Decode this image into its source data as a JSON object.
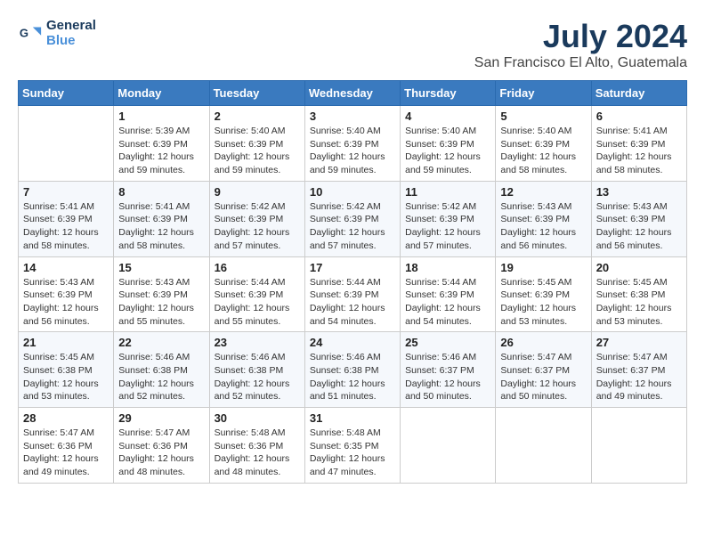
{
  "logo": {
    "line1": "General",
    "line2": "Blue"
  },
  "title": "July 2024",
  "location": "San Francisco El Alto, Guatemala",
  "days_of_week": [
    "Sunday",
    "Monday",
    "Tuesday",
    "Wednesday",
    "Thursday",
    "Friday",
    "Saturday"
  ],
  "weeks": [
    [
      {
        "day": "",
        "info": ""
      },
      {
        "day": "1",
        "info": "Sunrise: 5:39 AM\nSunset: 6:39 PM\nDaylight: 12 hours\nand 59 minutes."
      },
      {
        "day": "2",
        "info": "Sunrise: 5:40 AM\nSunset: 6:39 PM\nDaylight: 12 hours\nand 59 minutes."
      },
      {
        "day": "3",
        "info": "Sunrise: 5:40 AM\nSunset: 6:39 PM\nDaylight: 12 hours\nand 59 minutes."
      },
      {
        "day": "4",
        "info": "Sunrise: 5:40 AM\nSunset: 6:39 PM\nDaylight: 12 hours\nand 59 minutes."
      },
      {
        "day": "5",
        "info": "Sunrise: 5:40 AM\nSunset: 6:39 PM\nDaylight: 12 hours\nand 58 minutes."
      },
      {
        "day": "6",
        "info": "Sunrise: 5:41 AM\nSunset: 6:39 PM\nDaylight: 12 hours\nand 58 minutes."
      }
    ],
    [
      {
        "day": "7",
        "info": "Sunrise: 5:41 AM\nSunset: 6:39 PM\nDaylight: 12 hours\nand 58 minutes."
      },
      {
        "day": "8",
        "info": "Sunrise: 5:41 AM\nSunset: 6:39 PM\nDaylight: 12 hours\nand 58 minutes."
      },
      {
        "day": "9",
        "info": "Sunrise: 5:42 AM\nSunset: 6:39 PM\nDaylight: 12 hours\nand 57 minutes."
      },
      {
        "day": "10",
        "info": "Sunrise: 5:42 AM\nSunset: 6:39 PM\nDaylight: 12 hours\nand 57 minutes."
      },
      {
        "day": "11",
        "info": "Sunrise: 5:42 AM\nSunset: 6:39 PM\nDaylight: 12 hours\nand 57 minutes."
      },
      {
        "day": "12",
        "info": "Sunrise: 5:43 AM\nSunset: 6:39 PM\nDaylight: 12 hours\nand 56 minutes."
      },
      {
        "day": "13",
        "info": "Sunrise: 5:43 AM\nSunset: 6:39 PM\nDaylight: 12 hours\nand 56 minutes."
      }
    ],
    [
      {
        "day": "14",
        "info": "Sunrise: 5:43 AM\nSunset: 6:39 PM\nDaylight: 12 hours\nand 56 minutes."
      },
      {
        "day": "15",
        "info": "Sunrise: 5:43 AM\nSunset: 6:39 PM\nDaylight: 12 hours\nand 55 minutes."
      },
      {
        "day": "16",
        "info": "Sunrise: 5:44 AM\nSunset: 6:39 PM\nDaylight: 12 hours\nand 55 minutes."
      },
      {
        "day": "17",
        "info": "Sunrise: 5:44 AM\nSunset: 6:39 PM\nDaylight: 12 hours\nand 54 minutes."
      },
      {
        "day": "18",
        "info": "Sunrise: 5:44 AM\nSunset: 6:39 PM\nDaylight: 12 hours\nand 54 minutes."
      },
      {
        "day": "19",
        "info": "Sunrise: 5:45 AM\nSunset: 6:39 PM\nDaylight: 12 hours\nand 53 minutes."
      },
      {
        "day": "20",
        "info": "Sunrise: 5:45 AM\nSunset: 6:38 PM\nDaylight: 12 hours\nand 53 minutes."
      }
    ],
    [
      {
        "day": "21",
        "info": "Sunrise: 5:45 AM\nSunset: 6:38 PM\nDaylight: 12 hours\nand 53 minutes."
      },
      {
        "day": "22",
        "info": "Sunrise: 5:46 AM\nSunset: 6:38 PM\nDaylight: 12 hours\nand 52 minutes."
      },
      {
        "day": "23",
        "info": "Sunrise: 5:46 AM\nSunset: 6:38 PM\nDaylight: 12 hours\nand 52 minutes."
      },
      {
        "day": "24",
        "info": "Sunrise: 5:46 AM\nSunset: 6:38 PM\nDaylight: 12 hours\nand 51 minutes."
      },
      {
        "day": "25",
        "info": "Sunrise: 5:46 AM\nSunset: 6:37 PM\nDaylight: 12 hours\nand 50 minutes."
      },
      {
        "day": "26",
        "info": "Sunrise: 5:47 AM\nSunset: 6:37 PM\nDaylight: 12 hours\nand 50 minutes."
      },
      {
        "day": "27",
        "info": "Sunrise: 5:47 AM\nSunset: 6:37 PM\nDaylight: 12 hours\nand 49 minutes."
      }
    ],
    [
      {
        "day": "28",
        "info": "Sunrise: 5:47 AM\nSunset: 6:36 PM\nDaylight: 12 hours\nand 49 minutes."
      },
      {
        "day": "29",
        "info": "Sunrise: 5:47 AM\nSunset: 6:36 PM\nDaylight: 12 hours\nand 48 minutes."
      },
      {
        "day": "30",
        "info": "Sunrise: 5:48 AM\nSunset: 6:36 PM\nDaylight: 12 hours\nand 48 minutes."
      },
      {
        "day": "31",
        "info": "Sunrise: 5:48 AM\nSunset: 6:35 PM\nDaylight: 12 hours\nand 47 minutes."
      },
      {
        "day": "",
        "info": ""
      },
      {
        "day": "",
        "info": ""
      },
      {
        "day": "",
        "info": ""
      }
    ]
  ]
}
